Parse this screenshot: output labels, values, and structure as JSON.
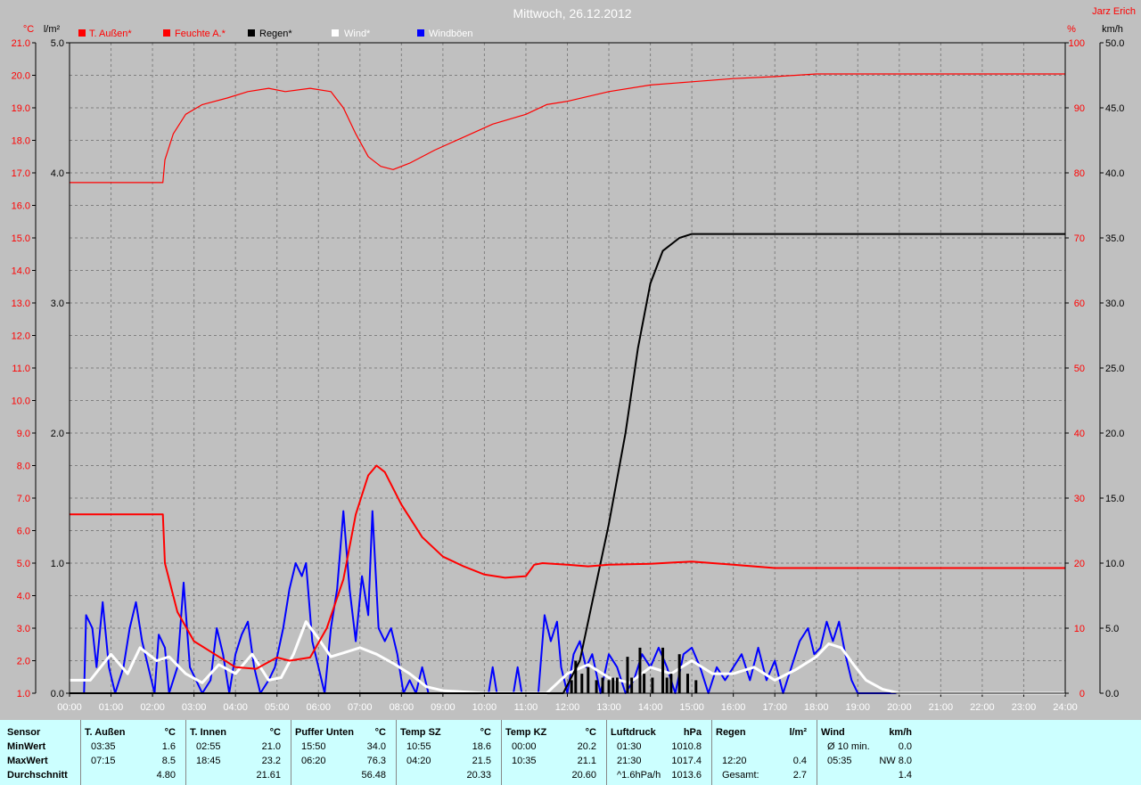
{
  "header": {
    "title": "Mittwoch, 26.12.2012",
    "author": "Jarz Erich"
  },
  "legend": [
    {
      "label": "T. Außen*",
      "color": "#ff0000"
    },
    {
      "label": "Feuchte A.*",
      "color": "#ff0000"
    },
    {
      "label": "Regen*",
      "color": "#000000"
    },
    {
      "label": "Wind*",
      "color": "#ffffff"
    },
    {
      "label": "Windböen",
      "color": "#0000ff"
    }
  ],
  "colors": {
    "background": "#c0c0c0",
    "plot_background": "#c0c0c0",
    "temp": "#ff0000",
    "humidity": "#ff0000",
    "rain": "#000000",
    "wind": "#ffffff",
    "gust": "#0000ff",
    "stats_background": "#ccffff"
  },
  "chart_data": {
    "type": "line",
    "x_unit": "hours",
    "xlim": [
      0,
      24
    ],
    "x_ticks": [
      "00:00",
      "01:00",
      "02:00",
      "03:00",
      "04:00",
      "05:00",
      "06:00",
      "07:00",
      "08:00",
      "09:00",
      "10:00",
      "11:00",
      "12:00",
      "13:00",
      "14:00",
      "15:00",
      "16:00",
      "17:00",
      "18:00",
      "19:00",
      "20:00",
      "21:00",
      "22:00",
      "23:00",
      "24:00"
    ],
    "grid": true,
    "axes": {
      "temp": {
        "unit_label": "°C",
        "range": [
          1,
          21
        ],
        "ticks": [
          "1.0",
          "2.0",
          "3.0",
          "4.0",
          "5.0",
          "6.0",
          "7.0",
          "8.0",
          "9.0",
          "10.0",
          "11.0",
          "12.0",
          "13.0",
          "14.0",
          "15.0",
          "16.0",
          "17.0",
          "18.0",
          "19.0",
          "20.0",
          "21.0"
        ]
      },
      "rain": {
        "unit_label": "l/m²",
        "range": [
          0,
          5
        ],
        "ticks": [
          "0.0",
          "1.0",
          "2.0",
          "3.0",
          "4.0",
          "5.0"
        ]
      },
      "humidity": {
        "unit_label": "%",
        "range": [
          0,
          100
        ],
        "ticks": [
          "0",
          "10",
          "20",
          "30",
          "40",
          "50",
          "60",
          "70",
          "80",
          "90",
          "100"
        ]
      },
      "wind": {
        "unit_label": "km/h",
        "range": [
          0,
          50
        ],
        "ticks": [
          "0.0",
          "5.0",
          "10.0",
          "15.0",
          "20.0",
          "25.0",
          "30.0",
          "35.0",
          "40.0",
          "45.0",
          "50.0"
        ]
      }
    },
    "series": [
      {
        "name": "T. Außen*",
        "axis": "temp",
        "points": [
          [
            0,
            6.5
          ],
          [
            2.25,
            6.5
          ],
          [
            2.3,
            5.0
          ],
          [
            2.6,
            3.5
          ],
          [
            3.0,
            2.6
          ],
          [
            3.5,
            2.2
          ],
          [
            4.0,
            1.8
          ],
          [
            4.5,
            1.75
          ],
          [
            5.0,
            2.1
          ],
          [
            5.3,
            2.0
          ],
          [
            5.8,
            2.1
          ],
          [
            6.2,
            3.0
          ],
          [
            6.6,
            4.5
          ],
          [
            6.9,
            6.5
          ],
          [
            7.2,
            7.7
          ],
          [
            7.4,
            8.0
          ],
          [
            7.6,
            7.8
          ],
          [
            8.0,
            6.8
          ],
          [
            8.5,
            5.8
          ],
          [
            9.0,
            5.2
          ],
          [
            9.5,
            4.9
          ],
          [
            10.0,
            4.65
          ],
          [
            10.5,
            4.55
          ],
          [
            11.0,
            4.6
          ],
          [
            11.2,
            4.95
          ],
          [
            11.4,
            5.0
          ],
          [
            12.0,
            4.95
          ],
          [
            12.5,
            4.9
          ],
          [
            13.0,
            4.95
          ],
          [
            14.0,
            4.98
          ],
          [
            15.0,
            5.05
          ],
          [
            16.0,
            4.95
          ],
          [
            17.0,
            4.85
          ],
          [
            18.0,
            4.85
          ],
          [
            24,
            4.85
          ]
        ]
      },
      {
        "name": "Feuchte A.*",
        "axis": "humidity",
        "points": [
          [
            0,
            78.5
          ],
          [
            2.25,
            78.5
          ],
          [
            2.3,
            82
          ],
          [
            2.5,
            86
          ],
          [
            2.8,
            89
          ],
          [
            3.2,
            90.5
          ],
          [
            3.8,
            91.5
          ],
          [
            4.3,
            92.5
          ],
          [
            4.8,
            93
          ],
          [
            5.2,
            92.5
          ],
          [
            5.8,
            93
          ],
          [
            6.3,
            92.5
          ],
          [
            6.6,
            90
          ],
          [
            6.9,
            86
          ],
          [
            7.2,
            82.5
          ],
          [
            7.5,
            81
          ],
          [
            7.8,
            80.5
          ],
          [
            8.2,
            81.5
          ],
          [
            8.8,
            83.5
          ],
          [
            9.5,
            85.5
          ],
          [
            10.2,
            87.5
          ],
          [
            11.0,
            89
          ],
          [
            11.5,
            90.5
          ],
          [
            12.0,
            91
          ],
          [
            13.0,
            92.5
          ],
          [
            14.0,
            93.5
          ],
          [
            15.0,
            94
          ],
          [
            16.0,
            94.5
          ],
          [
            17.0,
            94.8
          ],
          [
            18.0,
            95.2
          ],
          [
            24,
            95.2
          ]
        ]
      },
      {
        "name": "Regen*",
        "axis": "rain",
        "points": [
          [
            0,
            0
          ],
          [
            11.9,
            0
          ],
          [
            12.3,
            0.25
          ],
          [
            12.6,
            0.7
          ],
          [
            13.0,
            1.3
          ],
          [
            13.4,
            2.0
          ],
          [
            13.7,
            2.65
          ],
          [
            14.0,
            3.15
          ],
          [
            14.3,
            3.4
          ],
          [
            14.7,
            3.5
          ],
          [
            15.0,
            3.53
          ],
          [
            24,
            3.53
          ]
        ]
      },
      {
        "name": "Regen bars",
        "axis": "rain",
        "bars": [
          [
            12.1,
            0.1
          ],
          [
            12.2,
            0.25
          ],
          [
            12.35,
            0.15
          ],
          [
            12.5,
            0.2
          ],
          [
            12.7,
            0.1
          ],
          [
            12.85,
            0.12
          ],
          [
            13.0,
            0.1
          ],
          [
            13.1,
            0.12
          ],
          [
            13.2,
            0.12
          ],
          [
            13.45,
            0.28
          ],
          [
            13.55,
            0.12
          ],
          [
            13.75,
            0.35
          ],
          [
            13.85,
            0.15
          ],
          [
            14.05,
            0.12
          ],
          [
            14.3,
            0.35
          ],
          [
            14.4,
            0.12
          ],
          [
            14.5,
            0.15
          ],
          [
            14.7,
            0.3
          ],
          [
            14.9,
            0.15
          ],
          [
            15.1,
            0.1
          ]
        ]
      },
      {
        "name": "Wind*",
        "axis": "wind",
        "points": [
          [
            0,
            1
          ],
          [
            0.5,
            1
          ],
          [
            1.0,
            3
          ],
          [
            1.4,
            1.5
          ],
          [
            1.7,
            3.5
          ],
          [
            2.1,
            2.5
          ],
          [
            2.4,
            2.8
          ],
          [
            2.8,
            1.5
          ],
          [
            3.2,
            0.8
          ],
          [
            3.6,
            2.2
          ],
          [
            4.0,
            1.5
          ],
          [
            4.4,
            3
          ],
          [
            4.8,
            1
          ],
          [
            5.1,
            1.2
          ],
          [
            5.4,
            3
          ],
          [
            5.7,
            5.5
          ],
          [
            6.0,
            4.2
          ],
          [
            6.3,
            2.8
          ],
          [
            6.7,
            3.2
          ],
          [
            7.0,
            3.5
          ],
          [
            7.4,
            3
          ],
          [
            7.8,
            2.3
          ],
          [
            8.2,
            1.5
          ],
          [
            8.6,
            0.5
          ],
          [
            9.0,
            0.2
          ],
          [
            10,
            0
          ],
          [
            11.5,
            0
          ],
          [
            12.0,
            1.5
          ],
          [
            12.5,
            2.2
          ],
          [
            13.0,
            1.2
          ],
          [
            13.5,
            0.8
          ],
          [
            14.0,
            2
          ],
          [
            14.5,
            1.5
          ],
          [
            15.0,
            2.5
          ],
          [
            15.5,
            1.5
          ],
          [
            16.0,
            1.5
          ],
          [
            16.5,
            2
          ],
          [
            17.0,
            1
          ],
          [
            17.5,
            1.8
          ],
          [
            18.0,
            2.8
          ],
          [
            18.3,
            3.8
          ],
          [
            18.6,
            3.5
          ],
          [
            18.9,
            2.2
          ],
          [
            19.2,
            1
          ],
          [
            19.6,
            0.3
          ],
          [
            20.0,
            0
          ],
          [
            24,
            0
          ]
        ]
      },
      {
        "name": "Windböen",
        "axis": "wind",
        "points": [
          [
            0,
            0
          ],
          [
            0.35,
            0
          ],
          [
            0.4,
            6
          ],
          [
            0.55,
            5
          ],
          [
            0.65,
            2
          ],
          [
            0.8,
            7
          ],
          [
            0.95,
            2
          ],
          [
            1.1,
            0
          ],
          [
            1.3,
            2
          ],
          [
            1.45,
            5
          ],
          [
            1.6,
            7
          ],
          [
            1.75,
            4
          ],
          [
            1.9,
            2
          ],
          [
            2.05,
            0
          ],
          [
            2.15,
            4.5
          ],
          [
            2.3,
            3.5
          ],
          [
            2.4,
            0
          ],
          [
            2.6,
            2
          ],
          [
            2.75,
            8.5
          ],
          [
            2.9,
            2
          ],
          [
            3.05,
            1
          ],
          [
            3.2,
            0
          ],
          [
            3.4,
            1
          ],
          [
            3.55,
            5
          ],
          [
            3.7,
            3
          ],
          [
            3.85,
            0
          ],
          [
            4.0,
            3
          ],
          [
            4.15,
            4.5
          ],
          [
            4.3,
            5.5
          ],
          [
            4.45,
            2
          ],
          [
            4.6,
            0
          ],
          [
            4.8,
            1
          ],
          [
            4.95,
            2
          ],
          [
            5.15,
            5
          ],
          [
            5.3,
            8
          ],
          [
            5.45,
            10
          ],
          [
            5.6,
            9
          ],
          [
            5.7,
            10
          ],
          [
            5.85,
            4
          ],
          [
            6.0,
            2
          ],
          [
            6.15,
            0
          ],
          [
            6.3,
            5
          ],
          [
            6.45,
            8
          ],
          [
            6.6,
            14
          ],
          [
            6.75,
            8
          ],
          [
            6.9,
            4
          ],
          [
            7.05,
            9
          ],
          [
            7.2,
            6
          ],
          [
            7.3,
            14
          ],
          [
            7.45,
            5
          ],
          [
            7.6,
            4
          ],
          [
            7.75,
            5
          ],
          [
            7.9,
            3
          ],
          [
            8.05,
            0
          ],
          [
            8.2,
            1
          ],
          [
            8.35,
            0
          ],
          [
            8.5,
            2
          ],
          [
            8.65,
            0
          ],
          [
            10.1,
            0
          ],
          [
            10.2,
            2
          ],
          [
            10.3,
            0
          ],
          [
            10.7,
            0
          ],
          [
            10.8,
            2
          ],
          [
            10.9,
            0
          ],
          [
            11.3,
            0
          ],
          [
            11.45,
            6
          ],
          [
            11.6,
            4
          ],
          [
            11.75,
            5.5
          ],
          [
            11.85,
            2
          ],
          [
            12.0,
            0
          ],
          [
            12.15,
            3
          ],
          [
            12.3,
            4
          ],
          [
            12.45,
            2
          ],
          [
            12.6,
            3
          ],
          [
            12.8,
            0
          ],
          [
            13.0,
            3
          ],
          [
            13.2,
            2
          ],
          [
            13.4,
            0
          ],
          [
            13.6,
            1
          ],
          [
            13.8,
            3
          ],
          [
            14.0,
            2
          ],
          [
            14.2,
            3.5
          ],
          [
            14.4,
            2
          ],
          [
            14.6,
            0
          ],
          [
            14.8,
            3
          ],
          [
            15.0,
            3.5
          ],
          [
            15.2,
            2
          ],
          [
            15.4,
            0
          ],
          [
            15.6,
            2
          ],
          [
            15.8,
            1
          ],
          [
            16.0,
            2
          ],
          [
            16.2,
            3
          ],
          [
            16.4,
            1
          ],
          [
            16.6,
            3.5
          ],
          [
            16.8,
            1
          ],
          [
            17.0,
            2.5
          ],
          [
            17.2,
            0
          ],
          [
            17.4,
            2
          ],
          [
            17.6,
            4
          ],
          [
            17.8,
            5
          ],
          [
            17.95,
            3
          ],
          [
            18.1,
            3.5
          ],
          [
            18.25,
            5.5
          ],
          [
            18.4,
            4
          ],
          [
            18.55,
            5.5
          ],
          [
            18.7,
            3
          ],
          [
            18.85,
            1
          ],
          [
            19.0,
            0
          ],
          [
            24,
            0
          ]
        ]
      }
    ]
  },
  "stats": {
    "labels": {
      "sensor": "Sensor",
      "min": "MinWert",
      "max": "MaxWert",
      "avg": "Durchschnitt"
    },
    "columns": [
      {
        "name": "T. Außen",
        "unit": "°C",
        "min_time": "03:35",
        "min_val": "1.6",
        "max_time": "07:15",
        "max_val": "8.5",
        "avg_time": "",
        "avg_val": "4.80"
      },
      {
        "name": "T. Innen",
        "unit": "°C",
        "min_time": "02:55",
        "min_val": "21.0",
        "max_time": "18:45",
        "max_val": "23.2",
        "avg_time": "",
        "avg_val": "21.61"
      },
      {
        "name": "Puffer Unten",
        "unit": "°C",
        "min_time": "15:50",
        "min_val": "34.0",
        "max_time": "06:20",
        "max_val": "76.3",
        "avg_time": "",
        "avg_val": "56.48"
      },
      {
        "name": "Temp SZ",
        "unit": "°C",
        "min_time": "10:55",
        "min_val": "18.6",
        "max_time": "04:20",
        "max_val": "21.5",
        "avg_time": "",
        "avg_val": "20.33"
      },
      {
        "name": "Temp KZ",
        "unit": "°C",
        "min_time": "00:00",
        "min_val": "20.2",
        "max_time": "10:35",
        "max_val": "21.1",
        "avg_time": "",
        "avg_val": "20.60"
      },
      {
        "name": "Luftdruck",
        "unit": "hPa",
        "min_time": "01:30",
        "min_val": "1010.8",
        "max_time": "21:30",
        "max_val": "1017.4",
        "avg_time": "^1.6hPa/h",
        "avg_val": "1013.6"
      },
      {
        "name": "Regen",
        "unit": "l/m²",
        "min_time": "",
        "min_val": "",
        "max_time": "12:20",
        "max_val": "0.4",
        "avg_time": "Gesamt:",
        "avg_val": "2.7"
      },
      {
        "name": "Wind",
        "unit": "km/h",
        "min_time": "Ø 10 min.",
        "min_val": "0.0",
        "max_time": "05:35",
        "max_val": "NW 8.0",
        "avg_time": "",
        "avg_val": "1.4"
      }
    ]
  }
}
